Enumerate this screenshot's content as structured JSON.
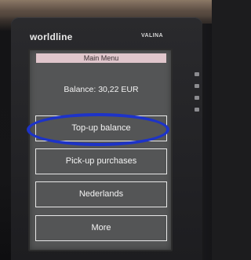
{
  "device": {
    "brand": "worldline",
    "model": "VALINA"
  },
  "screen": {
    "title": "Main Menu",
    "balance": "Balance: 30,22 EUR",
    "menu": [
      {
        "label": "Top-up balance",
        "highlighted": true
      },
      {
        "label": "Pick-up purchases",
        "highlighted": false
      },
      {
        "label": "Nederlands",
        "highlighted": false
      },
      {
        "label": "More",
        "highlighted": false
      }
    ]
  },
  "colors": {
    "title_bar": "#e0c6cc",
    "screen_bg": "#545556",
    "highlight_ring": "#1d33c8"
  }
}
